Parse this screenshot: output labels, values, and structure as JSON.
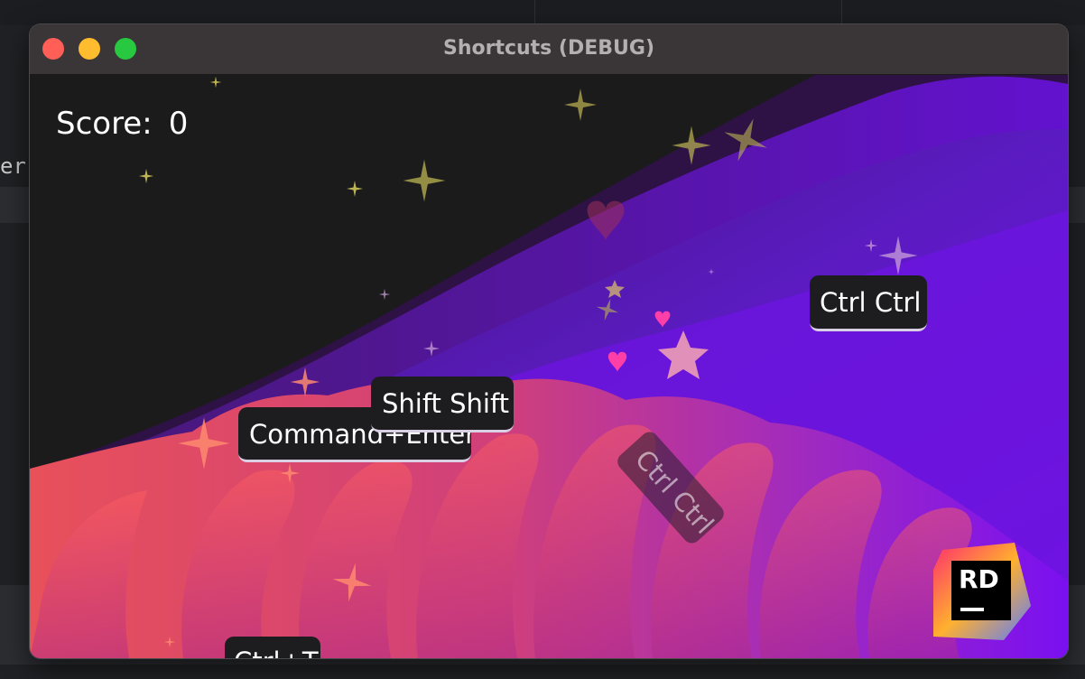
{
  "background": {
    "editor_fragment": "er"
  },
  "window": {
    "title": "Shortcuts (DEBUG)",
    "controls": {
      "close": "close",
      "minimize": "minimize",
      "maximize": "maximize"
    }
  },
  "game": {
    "score_label": "Score:",
    "score_value": "0",
    "shortcuts": [
      {
        "label": "Ctrl Ctrl"
      },
      {
        "label": "Command+Enter"
      },
      {
        "label": "Shift Shift"
      },
      {
        "label": "Ctrl Ctrl"
      },
      {
        "label": "Ctrl+T"
      }
    ],
    "logo_text": "RD"
  },
  "colors": {
    "sky": "#1b1b1c",
    "wave_dark": "#3d1560",
    "wave_purple": "#6a1fd6",
    "wave_coral": "#e0505a",
    "heart": "#ff3fa8",
    "star": "#c9c25a"
  }
}
